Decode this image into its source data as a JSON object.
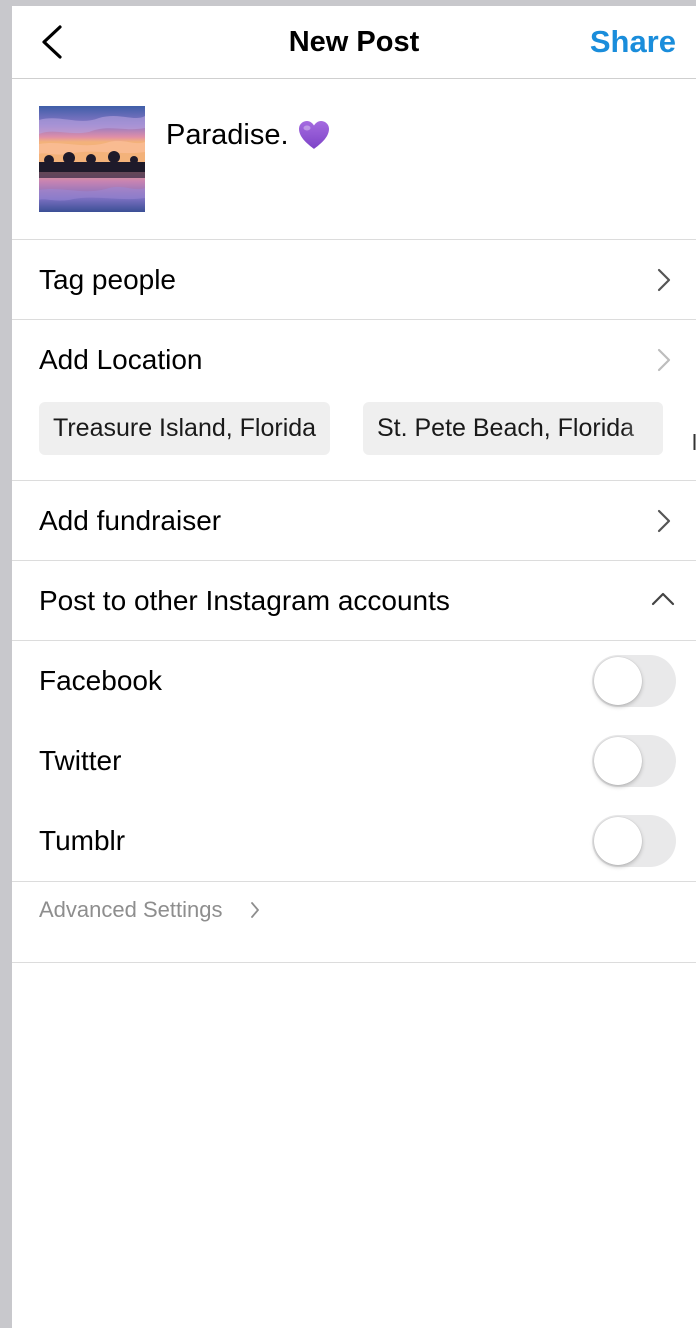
{
  "header": {
    "title": "New Post",
    "share_label": "Share",
    "back_icon": "chevron-left-icon",
    "accent_color": "#1a8ddb"
  },
  "post": {
    "caption": "Paradise.",
    "emoji_icon": "purple-heart-icon",
    "thumbnail": "sunset-lake-reflection-photo"
  },
  "menu": {
    "tag_people": "Tag people",
    "add_location": "Add Location",
    "location_suggestions": [
      "Treasure Island, Florida",
      "St. Pete Beach, Florida"
    ],
    "add_fundraiser": "Add fundraiser",
    "post_to_other": "Post to other Instagram accounts"
  },
  "share_targets": [
    {
      "label": "Facebook",
      "enabled": false
    },
    {
      "label": "Twitter",
      "enabled": false
    },
    {
      "label": "Tumblr",
      "enabled": false
    }
  ],
  "advanced": {
    "label": "Advanced Settings"
  }
}
